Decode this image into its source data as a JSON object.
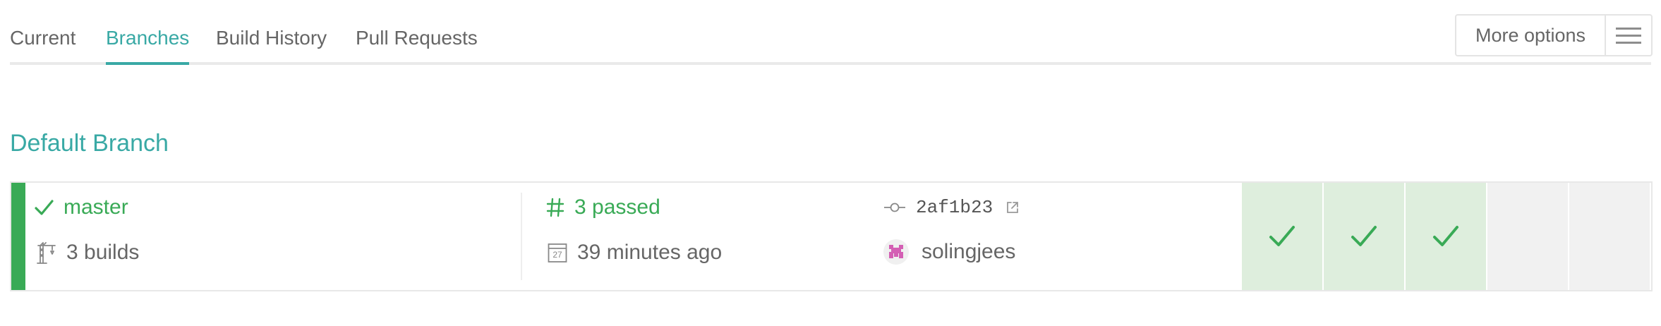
{
  "tabs": [
    {
      "label": "Current",
      "active": false
    },
    {
      "label": "Branches",
      "active": true
    },
    {
      "label": "Build History",
      "active": false
    },
    {
      "label": "Pull Requests",
      "active": false
    }
  ],
  "more_options": {
    "label": "More options",
    "icon": "hamburger-icon"
  },
  "section": {
    "title": "Default Branch"
  },
  "branch": {
    "name": "master",
    "status_icon": "check-icon",
    "builds_count": "3 builds",
    "builds_icon": "crane-icon",
    "build_status": "3 passed",
    "build_status_icon": "hash-icon",
    "time_ago": "39 minutes ago",
    "calendar_icon": "calendar-icon",
    "calendar_day": "27",
    "commit": "2af1b23",
    "commit_icon": "commit-icon",
    "external_icon": "external-link-icon",
    "author": "solingjees",
    "author_icon": "avatar"
  },
  "build_cells": [
    {
      "status": "passed",
      "icon": "check-icon"
    },
    {
      "status": "passed",
      "icon": "check-icon"
    },
    {
      "status": "passed",
      "icon": "check-icon"
    },
    {
      "status": "empty"
    },
    {
      "status": "empty"
    }
  ],
  "colors": {
    "accent": "#39a9a5",
    "passed": "#39aa56",
    "passed_cell": "#deeedd",
    "empty_cell": "#f1f1f1"
  }
}
